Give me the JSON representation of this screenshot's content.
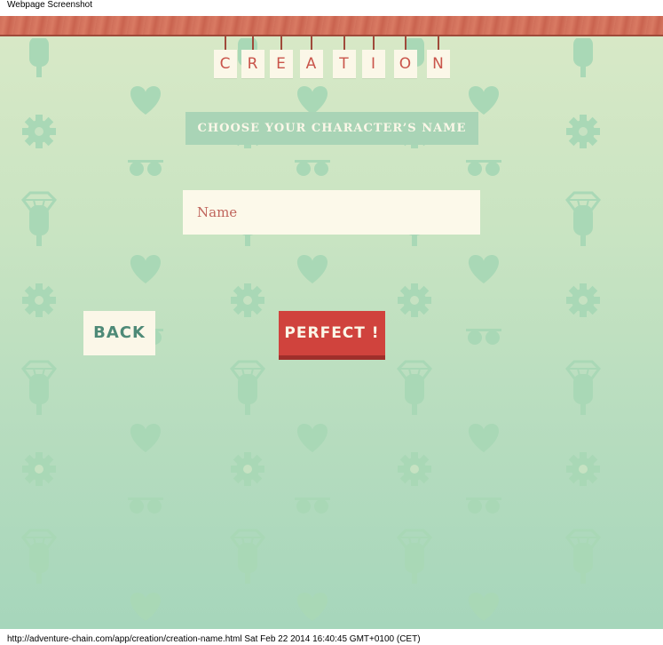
{
  "capture": {
    "title": "Webpage Screenshot",
    "footer": "http://adventure-chain.com/app/creation/creation-name.html Sat Feb 22 2014 16:40:45 GMT+0100 (CET)"
  },
  "page": {
    "tag_letters": [
      "C",
      "R",
      "E",
      "A",
      "T",
      "I",
      "O",
      "N"
    ],
    "subtitle": "CHOOSE YOUR CHARACTER’S NAME",
    "name_input": {
      "placeholder": "Name",
      "value": ""
    },
    "back_button": "BACK",
    "confirm_button": "PERFECT !"
  },
  "colors": {
    "background_top": "#d9e9c7",
    "background_bottom": "#a6d6bb",
    "pattern": "#a9d8b6",
    "accent_red": "#d0433d",
    "cream": "#fbf7e8",
    "wood": "#d06f5a"
  },
  "icons": [
    "popsicle-icon",
    "heart-icon",
    "gear-icon",
    "sunglasses-icon",
    "diamond-icon"
  ]
}
